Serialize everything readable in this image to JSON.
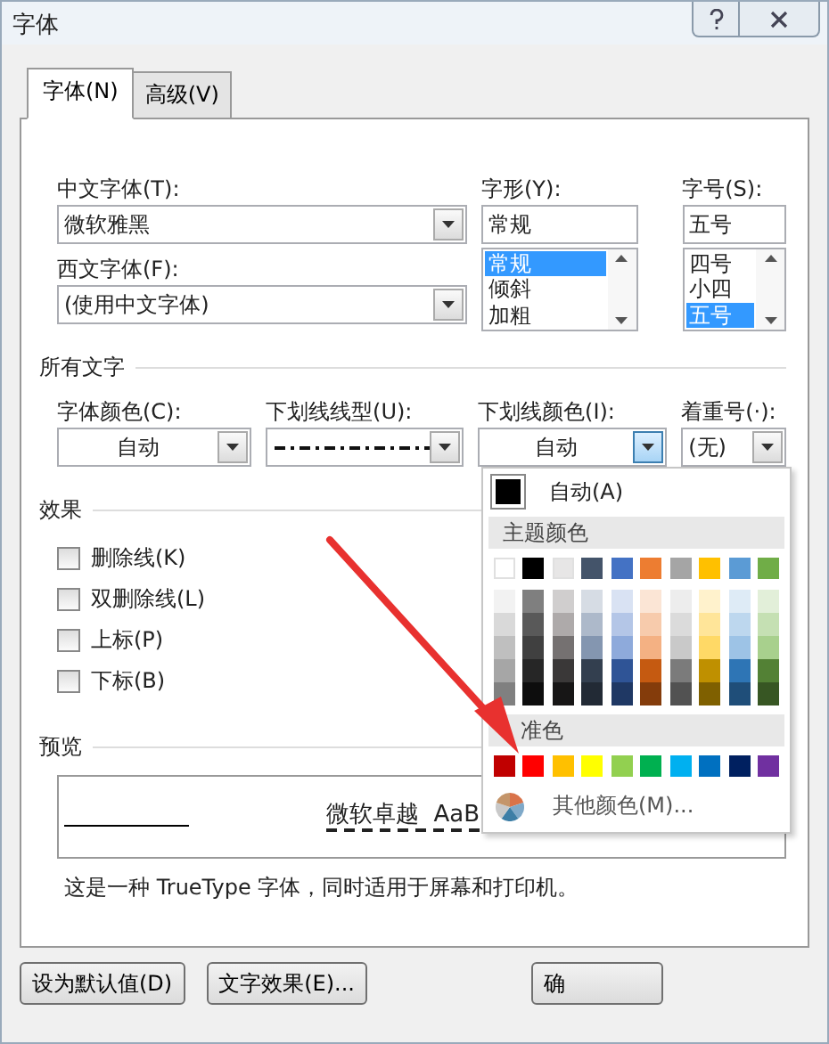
{
  "window": {
    "title": "字体"
  },
  "tabs": [
    {
      "label": "字体(N)",
      "selected": true
    },
    {
      "label": "高级(V)",
      "selected": false
    }
  ],
  "font_row": {
    "chinese_font": {
      "label": "中文字体(T):",
      "value": "微软雅黑"
    },
    "western_font": {
      "label": "西文字体(F):",
      "value": "(使用中文字体)"
    },
    "style": {
      "label": "字形(Y):",
      "value": "常规",
      "options": [
        {
          "label": "常规",
          "selected": true
        },
        {
          "label": "倾斜",
          "selected": false
        },
        {
          "label": "加粗",
          "selected": false
        }
      ]
    },
    "size": {
      "label": "字号(S):",
      "value": "五号",
      "options": [
        {
          "label": "四号",
          "selected": false
        },
        {
          "label": "小四",
          "selected": false
        },
        {
          "label": "五号",
          "selected": true
        }
      ]
    }
  },
  "all_text": {
    "header": "所有文字",
    "font_color": {
      "label": "字体颜色(C):",
      "value": "自动"
    },
    "underline_style": {
      "label": "下划线线型(U):"
    },
    "underline_color": {
      "label": "下划线颜色(I):",
      "value": "自动",
      "open": true
    },
    "emphasis": {
      "label": "着重号(·):",
      "value": "(无)"
    }
  },
  "effects": {
    "header": "效果",
    "items": [
      {
        "label": "删除线(K)",
        "checked": false
      },
      {
        "label": "双删除线(L)",
        "checked": false
      },
      {
        "label": "上标(P)",
        "checked": false
      },
      {
        "label": "下标(B)",
        "checked": false
      }
    ]
  },
  "preview": {
    "header": "预览",
    "sample": "微软卓越  AaB",
    "description": "这是一种 TrueType 字体，同时适用于屏幕和打印机。"
  },
  "buttons": [
    {
      "label": "设为默认值(D)"
    },
    {
      "label": "文字效果(E)..."
    },
    {
      "label": "确"
    }
  ],
  "color_menu": {
    "auto_label": "自动(A)",
    "theme_header": "主题颜色",
    "theme_colors": [
      {
        "color": "#ffffff",
        "shades": [
          {
            "color": "#f2f2f2"
          },
          {
            "color": "#d9d9d9"
          },
          {
            "color": "#bfbfbf"
          },
          {
            "color": "#a6a6a6"
          },
          {
            "color": "#808080"
          }
        ]
      },
      {
        "color": "#000000",
        "shades": [
          {
            "color": "#7f7f7f"
          },
          {
            "color": "#595959"
          },
          {
            "color": "#404040"
          },
          {
            "color": "#262626"
          },
          {
            "color": "#0d0d0d"
          }
        ]
      },
      {
        "color": "#e7e6e6",
        "shades": [
          {
            "color": "#d0cece"
          },
          {
            "color": "#aeaaaa"
          },
          {
            "color": "#757171"
          },
          {
            "color": "#3a3838"
          },
          {
            "color": "#171616"
          }
        ]
      },
      {
        "color": "#44546a",
        "shades": [
          {
            "color": "#d6dce4"
          },
          {
            "color": "#adb9ca"
          },
          {
            "color": "#8496b0"
          },
          {
            "color": "#333f4f"
          },
          {
            "color": "#222a35"
          }
        ]
      },
      {
        "color": "#4472c4",
        "shades": [
          {
            "color": "#d9e2f3"
          },
          {
            "color": "#b4c6e7"
          },
          {
            "color": "#8eaadb"
          },
          {
            "color": "#2f5496"
          },
          {
            "color": "#1f3864"
          }
        ]
      },
      {
        "color": "#ed7d31",
        "shades": [
          {
            "color": "#fbe5d5"
          },
          {
            "color": "#f7cbac"
          },
          {
            "color": "#f4b183"
          },
          {
            "color": "#c55a11"
          },
          {
            "color": "#843c0b"
          }
        ]
      },
      {
        "color": "#a5a5a5",
        "shades": [
          {
            "color": "#ededed"
          },
          {
            "color": "#dbdbdb"
          },
          {
            "color": "#c9c9c9"
          },
          {
            "color": "#7b7b7b"
          },
          {
            "color": "#525252"
          }
        ]
      },
      {
        "color": "#ffc000",
        "shades": [
          {
            "color": "#fff2cc"
          },
          {
            "color": "#ffe599"
          },
          {
            "color": "#ffd966"
          },
          {
            "color": "#bf9000"
          },
          {
            "color": "#7f6000"
          }
        ]
      },
      {
        "color": "#5b9bd5",
        "shades": [
          {
            "color": "#deebf6"
          },
          {
            "color": "#bdd7ee"
          },
          {
            "color": "#9dc3e6"
          },
          {
            "color": "#2e75b5"
          },
          {
            "color": "#1f4e79"
          }
        ]
      },
      {
        "color": "#70ad47",
        "shades": [
          {
            "color": "#e2efd9"
          },
          {
            "color": "#c5e0b3"
          },
          {
            "color": "#a8d08d"
          },
          {
            "color": "#538135"
          },
          {
            "color": "#375623"
          }
        ]
      }
    ],
    "standard_header": "准色",
    "standard_colors": [
      {
        "color": "#c00000"
      },
      {
        "color": "#ff0000"
      },
      {
        "color": "#ffc000"
      },
      {
        "color": "#ffff00"
      },
      {
        "color": "#92d050"
      },
      {
        "color": "#00b050"
      },
      {
        "color": "#00b0f0"
      },
      {
        "color": "#0070c0"
      },
      {
        "color": "#002060"
      },
      {
        "color": "#7030a0"
      }
    ],
    "more_label": "其他颜色(M)..."
  }
}
